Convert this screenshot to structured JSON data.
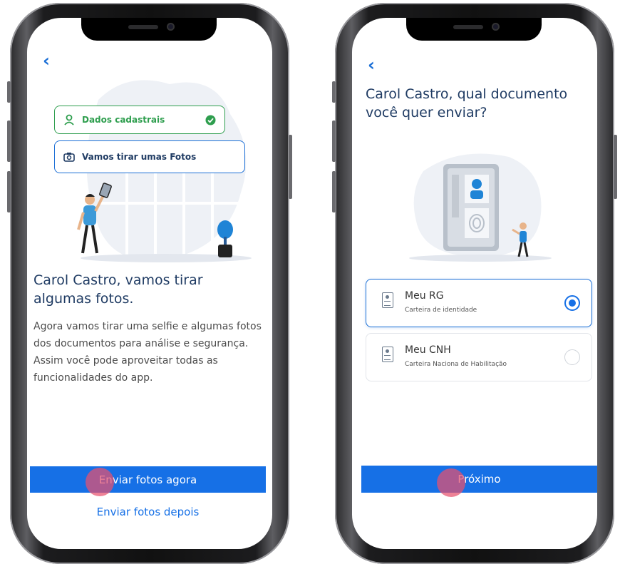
{
  "left_screen": {
    "back_glyph": "‹",
    "steps": [
      {
        "label": "Dados cadastrais",
        "status": "done",
        "color": "#2e9e4e"
      },
      {
        "label": "Vamos tirar umas Fotos",
        "status": "current",
        "color": "#1b6fd6"
      }
    ],
    "title": "Carol Castro, vamos tirar algumas fotos.",
    "description": "Agora vamos tirar uma selfie e algumas fotos dos documentos para análise e segurança. Assim você pode aproveitar todas as funcionalidades do app.",
    "primary_button": "Enviar fotos agora",
    "secondary_link": "Enviar fotos depois"
  },
  "right_screen": {
    "back_glyph": "‹",
    "title": "Carol Castro, qual documento você quer enviar?",
    "options": [
      {
        "label": "Meu RG",
        "sublabel": "Carteira de identidade",
        "selected": true,
        "icon": "id-card-icon"
      },
      {
        "label": "Meu CNH",
        "sublabel": "Carteira Naciona de Habilitação",
        "selected": false,
        "icon": "id-card-icon"
      }
    ],
    "primary_button": "Próximo"
  },
  "colors": {
    "accent": "#1670e6",
    "success": "#2e9e4e",
    "title": "#1f3b63",
    "touch": "#e8506e"
  }
}
